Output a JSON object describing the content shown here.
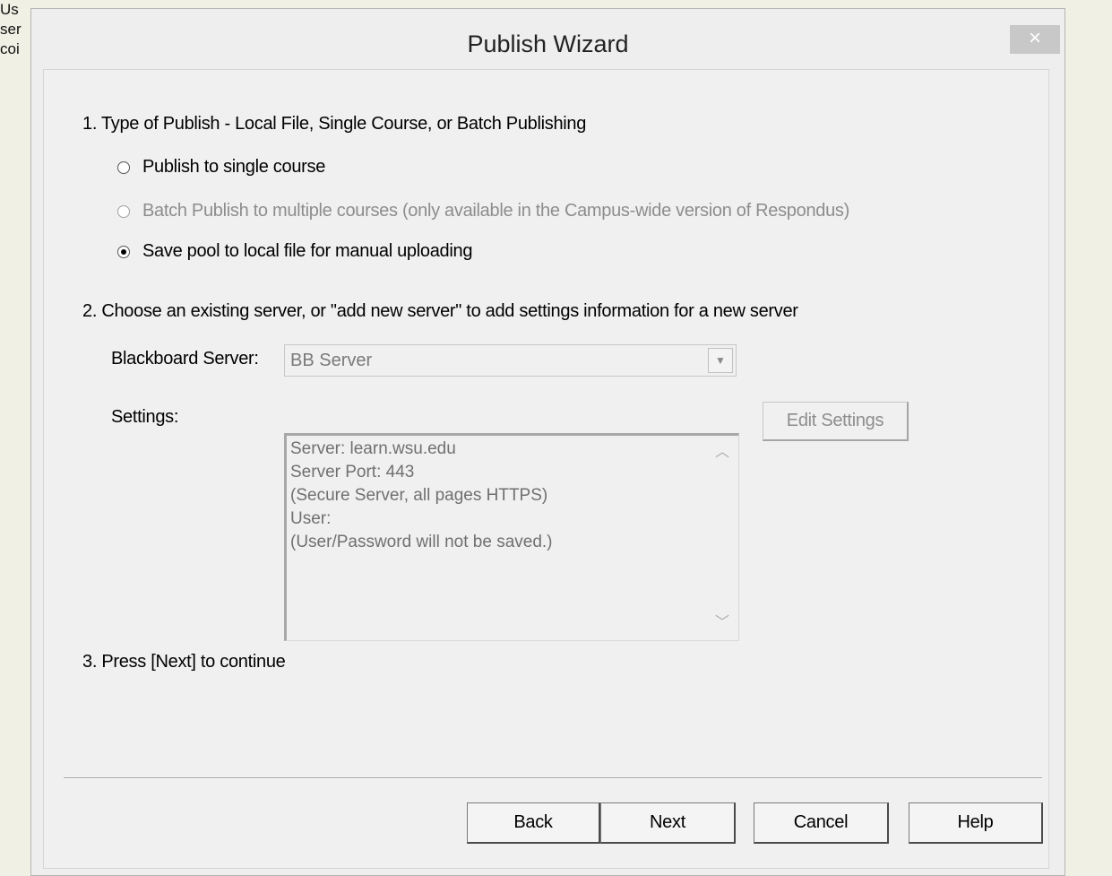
{
  "background_text": [
    "Us",
    "ser",
    "coi"
  ],
  "dialog": {
    "title": "Publish Wizard",
    "close_label": "×"
  },
  "step1": {
    "label": "1.  Type of Publish - Local File, Single Course, or Batch Publishing",
    "options": [
      {
        "label": "Publish to single course",
        "checked": false,
        "enabled": true
      },
      {
        "label": "Batch Publish to multiple courses (only available in the Campus-wide version of Respondus)",
        "checked": false,
        "enabled": false
      },
      {
        "label": "Save pool to local file for manual uploading",
        "checked": true,
        "enabled": true
      }
    ]
  },
  "step2": {
    "label": "2.  Choose an existing server, or \"add new server\" to add settings information for a new server",
    "server_label": "Blackboard Server:",
    "server_value": "BB Server",
    "settings_label": "Settings:",
    "settings_lines": [
      "Server: learn.wsu.edu",
      "Server Port: 443",
      "(Secure Server, all pages HTTPS)",
      "User:",
      "(User/Password will not be saved.)"
    ],
    "edit_settings_label": "Edit Settings"
  },
  "step3": {
    "label": "3.  Press [Next] to continue"
  },
  "buttons": {
    "back": "Back",
    "next": "Next",
    "cancel": "Cancel",
    "help": "Help"
  }
}
